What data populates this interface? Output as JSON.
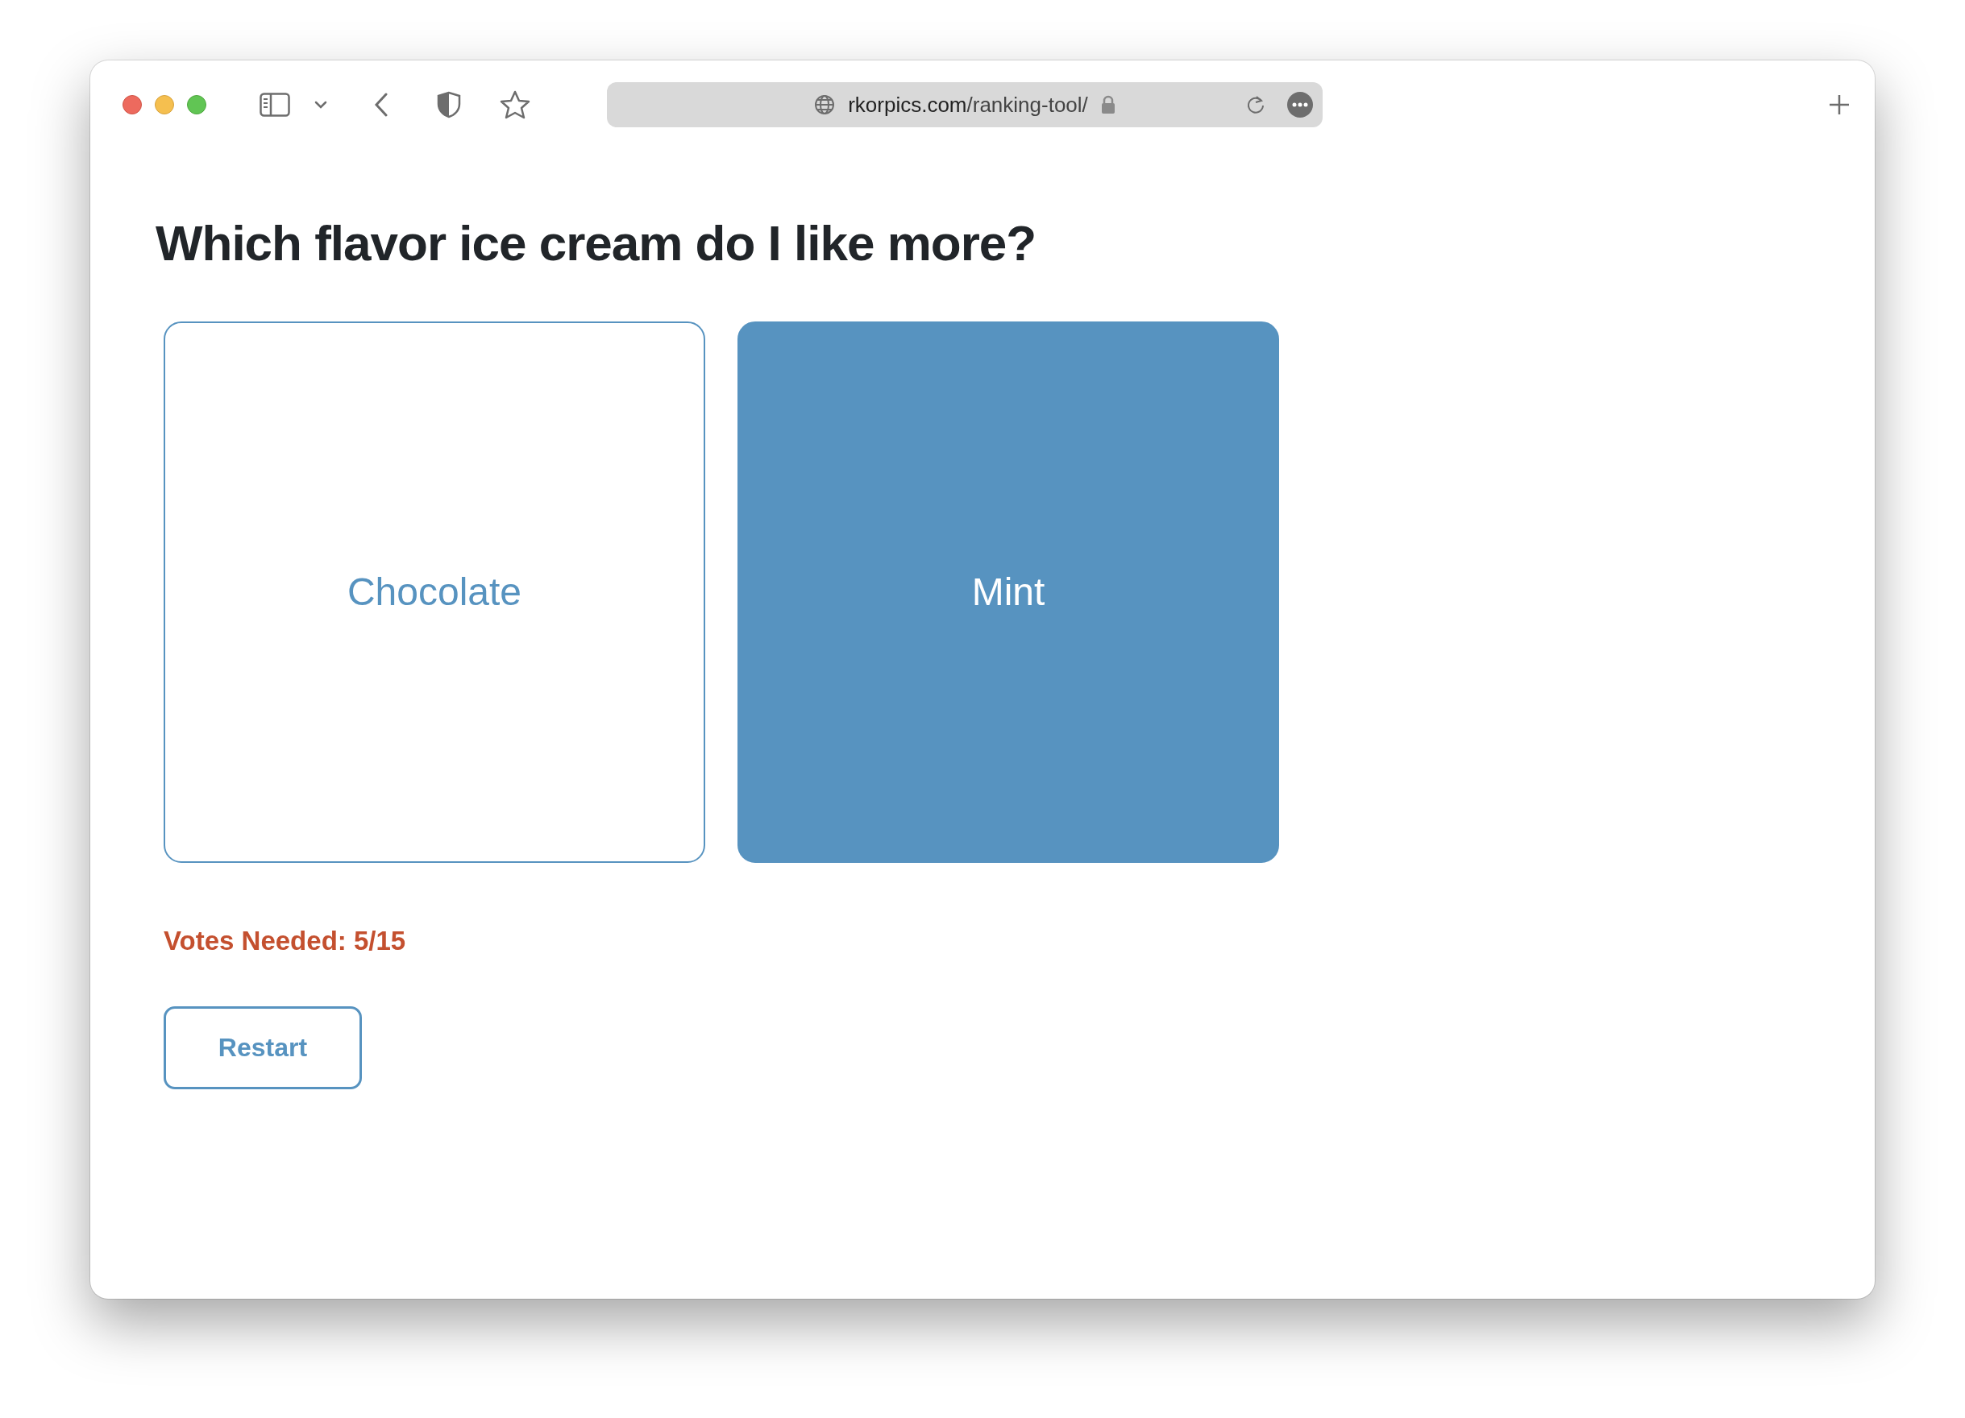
{
  "browser": {
    "url_domain": "rkorpics.com",
    "url_path": "/ranking-tool/"
  },
  "page": {
    "title": "Which flavor ice cream do I like more?",
    "choices": [
      {
        "label": "Chocolate",
        "selected": false
      },
      {
        "label": "Mint",
        "selected": true
      }
    ],
    "votes_needed": "Votes Needed: 5/15",
    "restart_button": "Restart"
  }
}
